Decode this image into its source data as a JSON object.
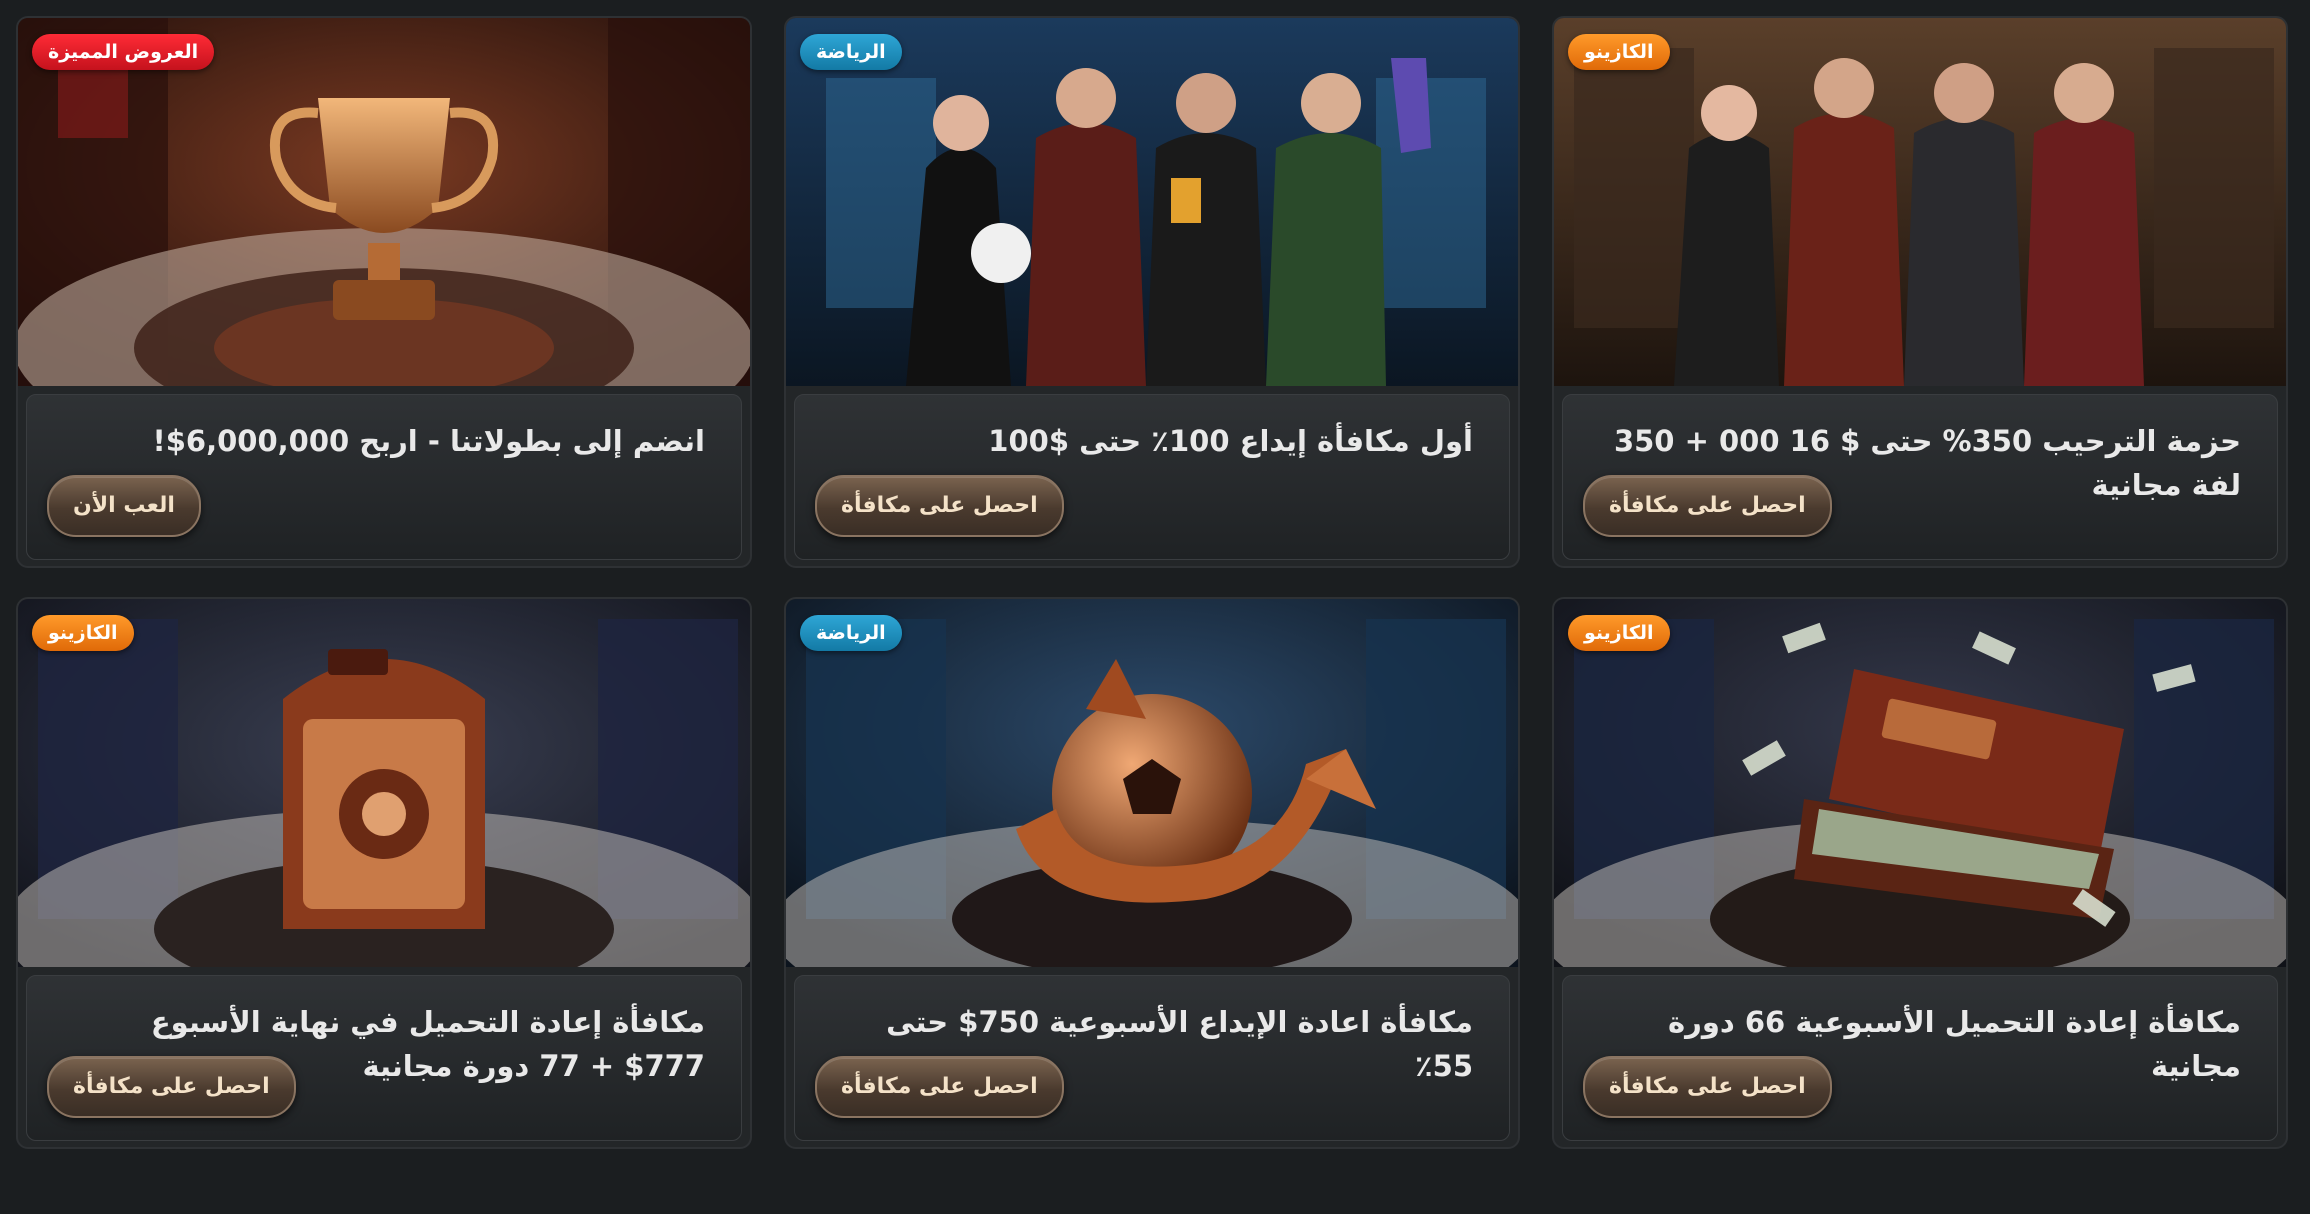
{
  "cards": [
    {
      "badge": "العروض المميزة",
      "badge_color": "#e3182a",
      "image": "trophy-cup-illustration",
      "title": "انضم إلى بطولاتنا - اربح 6,000,000$!",
      "button": "العب الأن"
    },
    {
      "badge": "الرياضة",
      "badge_color": "#1b8fc0",
      "image": "four-characters-sports-bar",
      "title": "أول مكافأة إيداع 100٪ حتى $100",
      "button": "احصل على مكافأة"
    },
    {
      "badge": "الكازينو",
      "badge_color": "#f0821a",
      "image": "four-characters-casino-hall",
      "title": "حزمة الترحيب 350% حتى $ 16 000 + 350 لفة مجانية",
      "button": "احصل على مكافأة"
    },
    {
      "badge": "الكازينو",
      "badge_color": "#f0821a",
      "image": "fri-sun-slot-safe",
      "title": "مكافأة إعادة التحميل في نهاية الأسبوع 777$ + 77 دورة مجانية",
      "button": "احصل على مكافأة"
    },
    {
      "badge": "الرياضة",
      "badge_color": "#1b8fc0",
      "image": "bronze-football-arrow",
      "title": "مكافأة اعادة الإيداع الأسبوعية 750$ حتى 55٪",
      "button": "احصل على مكافأة"
    },
    {
      "badge": "الكازينو",
      "badge_color": "#f0821a",
      "image": "mon-thu-money-suitcase",
      "title": "مكافأة إعادة التحميل الأسبوعية 66 دورة مجانية",
      "button": "احصل على مكافأة"
    }
  ]
}
